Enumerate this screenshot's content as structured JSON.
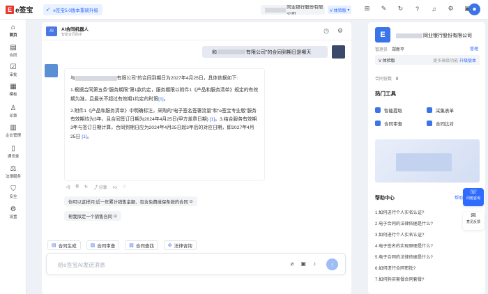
{
  "topbar": {
    "logo_mark": "E",
    "logo_text": "e签宝",
    "promo": "e签宝5.0版本重磅升级",
    "company_suffix": "同业银行股份有限公司",
    "version_badge": "V 体验版",
    "icons": [
      "org-chart-icon",
      "edit-icon",
      "refresh-icon",
      "help-icon",
      "notification-icon",
      "settings-icon",
      "message-icon"
    ]
  },
  "nav": {
    "items": [
      {
        "label": "首页",
        "icon": "home-icon"
      },
      {
        "label": "合同",
        "icon": "contract-icon"
      },
      {
        "label": "审批",
        "icon": "approve-icon"
      },
      {
        "label": "模板",
        "icon": "template-icon"
      },
      {
        "label": "印章",
        "icon": "seal-icon"
      },
      {
        "label": "企业管理",
        "icon": "enterprise-icon"
      },
      {
        "label": "通讯录",
        "icon": "contacts-icon"
      },
      {
        "label": "法律服务",
        "icon": "law-icon"
      },
      {
        "label": "安全",
        "icon": "security-icon"
      },
      {
        "label": "设置",
        "icon": "settings-icon"
      }
    ]
  },
  "chat": {
    "bot_name": "AI合同机器人",
    "bot_sub": "智能合同助手",
    "user_msg_prefix": "和",
    "user_msg_suffix": "有限公司”的合同到期日是哪天",
    "answer": {
      "p1_a": "与",
      "p1_b": "有限公司”的合同到期日为2027年4月25日，具体依据如下:",
      "p2": "1.根据合同第五条“服务期限”第1款约定，服务期限以附件1《产品和服务清单》规定的有效期为准，且最长不超过有效期1约定的时限",
      "p2_ref": "[1]",
      "p2_end": "。",
      "p3": "2.附件1《产品和服务清单》中明确标注，采购的“电子签名签署流量”和“e签宝专业版”服务有效期均为3年，且合同签订日期为2024年4月25日(甲方盖章日期)",
      "p3_ref": "[1]",
      "p3_b": "。3.结合服务有效期3年与签订日期计算，合同到期日应为2024年4月25日起3年后的对应日期，即2027年4月25日",
      "p3_ref2": "[1]",
      "p3_end": "。"
    },
    "share_label": "分享",
    "suggestions": [
      "你可以这样问:近一年累计销售金额、包含免费维保条款的合同",
      "帮我拟定一个销售合同"
    ],
    "quick_actions": [
      {
        "label": "合同生成",
        "icon": "doc-generate-icon"
      },
      {
        "label": "合同审查",
        "icon": "doc-review-icon"
      },
      {
        "label": "合同查找",
        "icon": "doc-search-icon"
      },
      {
        "label": "法律咨询",
        "icon": "law-consult-icon"
      }
    ],
    "input_placeholder": "给e签宝AI发送消息"
  },
  "right": {
    "company_suffix": "同业银行股份有限公司",
    "admin_label": "管理员",
    "admin_name": "郑新平",
    "manage_label": "管理",
    "plan_label": "V 体验版",
    "plan_more": "更多高级功能",
    "plan_upgrade": "升级版本",
    "balance_label": "合同份数",
    "balance_value": "0",
    "hot_tools_title": "热门工具",
    "tools": [
      "智能提取",
      "采集表单",
      "合同审查",
      "合同比对"
    ],
    "help_title": "帮助中心",
    "help_more": "帮助",
    "help_items": [
      "1.如何进行个人实名认证?",
      "2.电子合同的法律依据是什么?",
      "3.如何进行个人实名认证?",
      "4.电子签名的实现原理是什么?",
      "5.电子合同的法律依据是什么?",
      "6.如何进行合同审批?",
      "7.如何购买套餐合同套餐?"
    ]
  },
  "float": {
    "contact": "问题咨询",
    "feedback": "意见反馈"
  }
}
